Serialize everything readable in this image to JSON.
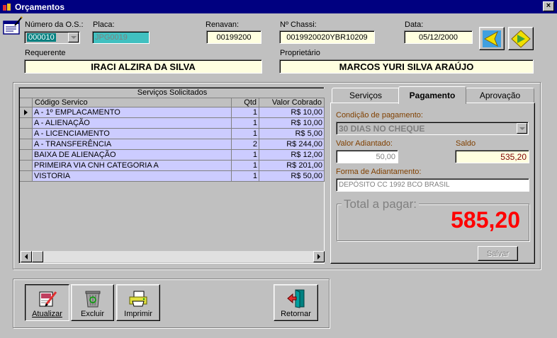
{
  "window": {
    "title": "Orçamentos",
    "close_label": "×"
  },
  "header": {
    "os_label": "Número da O.S.:",
    "os_value": "000010",
    "placa_label": "Placa:",
    "placa_value": "JPG0019",
    "renavan_label": "Renavan:",
    "renavan_value": "00199200",
    "chassi_label": "Nº Chassi:",
    "chassi_value": "0019920020YBR10209",
    "data_label": "Data:",
    "data_value": "05/12/2000",
    "requerente_label": "Requerente",
    "requerente_value": "IRACI ALZIRA DA SILVA",
    "proprietario_label": "Proprietário",
    "proprietario_value": "MARCOS YURI SILVA ARAÚJO"
  },
  "grid": {
    "caption": "Serviços Solicitados",
    "columns": [
      "Código Servico",
      "Qtd",
      "Valor Cobrado"
    ],
    "rows": [
      {
        "servico": "A - 1º EMPLACAMENTO",
        "qtd": "1",
        "valor": "R$ 10,00"
      },
      {
        "servico": "A - ALIENAÇÃO",
        "qtd": "1",
        "valor": "R$ 10,00"
      },
      {
        "servico": "A - LICENCIAMENTO",
        "qtd": "1",
        "valor": "R$ 5,00"
      },
      {
        "servico": "A - TRANSFERÊNCIA",
        "qtd": "2",
        "valor": "R$ 244,00"
      },
      {
        "servico": "BAIXA DE ALIENAÇÃO",
        "qtd": "1",
        "valor": "R$ 12,00"
      },
      {
        "servico": "PRIMEIRA VIA CNH CATEGORIA A",
        "qtd": "1",
        "valor": "R$ 201,00"
      },
      {
        "servico": "VISTORIA",
        "qtd": "1",
        "valor": "R$ 50,00"
      }
    ]
  },
  "tabs": {
    "servicos": "Serviços",
    "pagamento": "Pagamento",
    "aprovacao": "Aprovação"
  },
  "pagamento": {
    "condicao_label": "Condição de pagamento:",
    "condicao_value": "30 DIAS NO CHEQUE",
    "adiantado_label": "Valor Adiantado:",
    "adiantado_value": "50,00",
    "saldo_label": "Saldo",
    "saldo_value": "535,20",
    "forma_label": "Forma de Adiantamento:",
    "forma_value": "DEPÓSITO CC 1992 BCO BRASIL",
    "total_label": "Total a pagar:",
    "total_value": "585,20",
    "salvar_label": "Salvar"
  },
  "toolbar": {
    "atualizar": "Atualizar",
    "excluir": "Excluir",
    "imprimir": "Imprimir",
    "retornar": "Retornar"
  },
  "colors": {
    "titlebar": "#000080",
    "field_bg": "#ffffe0",
    "grid_row": "#ccccff",
    "total": "#ff0000",
    "label_brown": "#804000"
  }
}
